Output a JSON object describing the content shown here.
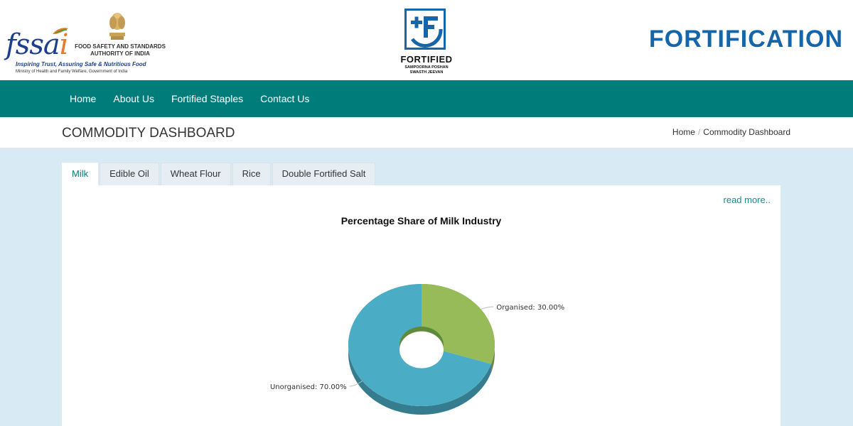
{
  "header": {
    "fssai_logo_text": "fssai",
    "authority_line1": "FOOD SAFETY AND STANDARDS",
    "authority_line2": "AUTHORITY OF INDIA",
    "tagline": "Inspiring Trust, Assuring Safe & Nutritious Food",
    "ministry": "Ministry of Health and Family Welfare, Government of India",
    "fortified_logo_title": "FORTIFIED",
    "fortified_logo_sub1": "SAMPOORNA POSHAN",
    "fortified_logo_sub2": "SWASTH JEEVAN",
    "site_title": "FORTIFICATION"
  },
  "nav": {
    "items": [
      {
        "label": "Home"
      },
      {
        "label": "About Us"
      },
      {
        "label": "Fortified Staples"
      },
      {
        "label": "Contact Us"
      }
    ]
  },
  "page": {
    "title": "COMMODITY DASHBOARD",
    "breadcrumb": [
      {
        "label": "Home"
      },
      {
        "label": "Commodity Dashboard"
      }
    ],
    "breadcrumb_separator": "/"
  },
  "tabs": {
    "items": [
      {
        "label": "Milk",
        "active": true
      },
      {
        "label": "Edible Oil",
        "active": false
      },
      {
        "label": "Wheat Flour",
        "active": false
      },
      {
        "label": "Rice",
        "active": false
      },
      {
        "label": "Double Fortified Salt",
        "active": false
      }
    ]
  },
  "panel": {
    "read_more": "read more.."
  },
  "chart_data": {
    "type": "pie",
    "variant": "3d-donut",
    "title": "Percentage Share of Milk Industry",
    "slices": [
      {
        "name": "Organised",
        "value": 30.0,
        "label": "Organised: 30.00%",
        "color": "#98bb59"
      },
      {
        "name": "Unorganised",
        "value": 70.0,
        "label": "Unorganised: 70.00%",
        "color": "#4bacc6"
      }
    ],
    "legend": "none"
  },
  "colors": {
    "nav_bg": "#007d7b",
    "brand_blue": "#1565a8",
    "main_bg": "#d8ebf5",
    "active_tab_text": "#007d7b",
    "link": "#1b8a8a"
  }
}
